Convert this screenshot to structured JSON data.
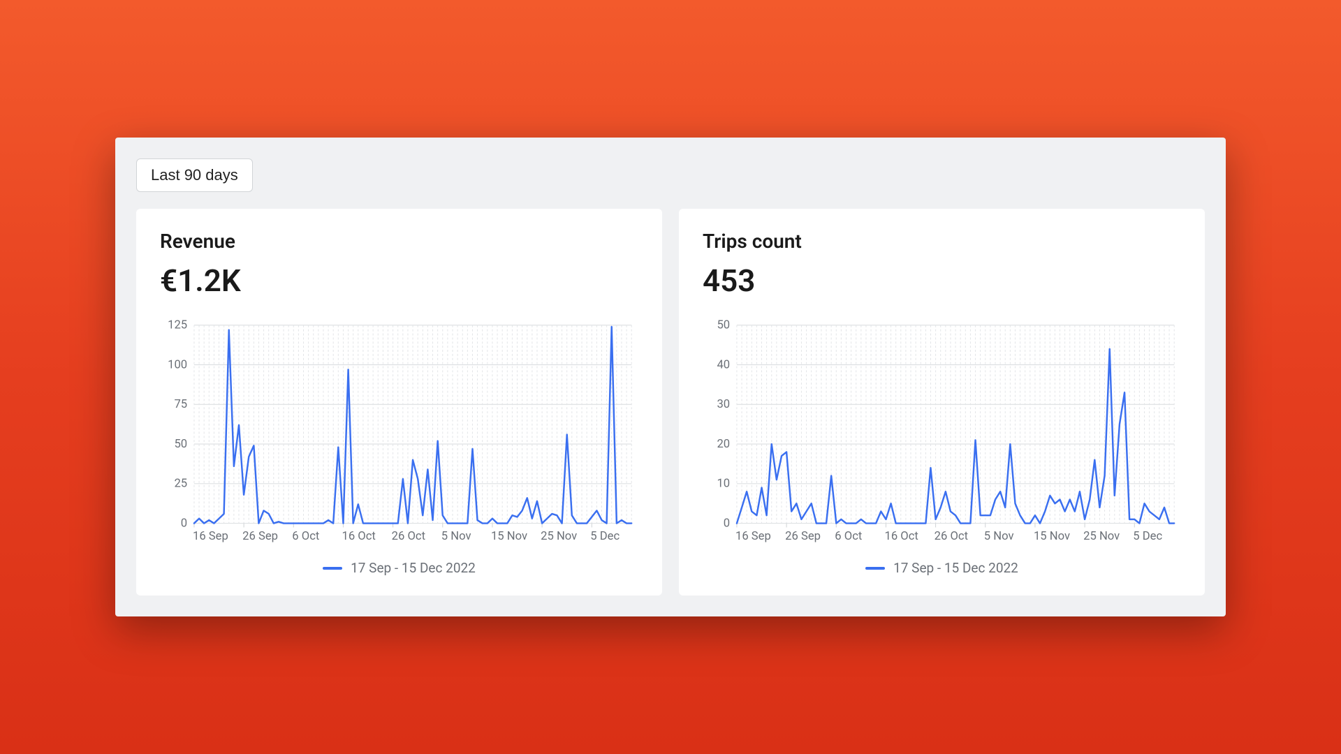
{
  "controls": {
    "date_range_label": "Last 90 days"
  },
  "cards": {
    "revenue": {
      "title": "Revenue",
      "value": "€1.2K",
      "legend": "17 Sep - 15 Dec 2022"
    },
    "trips": {
      "title": "Trips count",
      "value": "453",
      "legend": "17 Sep - 15 Dec 2022"
    }
  },
  "colors": {
    "series": "#3a6ff0"
  },
  "chart_data": [
    {
      "id": "revenue",
      "type": "line",
      "title": "Revenue",
      "ylabel": "",
      "xlabel": "",
      "ylim": [
        0,
        125
      ],
      "y_ticks": [
        0,
        25,
        50,
        75,
        100,
        125
      ],
      "x_tick_labels": [
        "16 Sep",
        "26 Sep",
        "6 Oct",
        "16 Oct",
        "26 Oct",
        "5 Nov",
        "15 Nov",
        "25 Nov",
        "5 Dec"
      ],
      "x_tick_indices": [
        0,
        10,
        20,
        30,
        40,
        50,
        60,
        70,
        80
      ],
      "legend": "17 Sep - 15 Dec 2022",
      "series": [
        {
          "name": "17 Sep - 15 Dec 2022",
          "x": [
            0,
            1,
            2,
            3,
            4,
            5,
            6,
            7,
            8,
            9,
            10,
            11,
            12,
            13,
            14,
            15,
            16,
            17,
            18,
            19,
            20,
            21,
            22,
            23,
            24,
            25,
            26,
            27,
            28,
            29,
            30,
            31,
            32,
            33,
            34,
            35,
            36,
            37,
            38,
            39,
            40,
            41,
            42,
            43,
            44,
            45,
            46,
            47,
            48,
            49,
            50,
            51,
            52,
            53,
            54,
            55,
            56,
            57,
            58,
            59,
            60,
            61,
            62,
            63,
            64,
            65,
            66,
            67,
            68,
            69,
            70,
            71,
            72,
            73,
            74,
            75,
            76,
            77,
            78,
            79,
            80,
            81,
            82,
            83,
            84,
            85,
            86,
            87,
            88
          ],
          "values": [
            0,
            3,
            0,
            2,
            0,
            3,
            6,
            122,
            36,
            62,
            18,
            42,
            49,
            0,
            8,
            6,
            0,
            1,
            0,
            0,
            0,
            0,
            0,
            0,
            0,
            0,
            0,
            2,
            0,
            48,
            0,
            97,
            0,
            12,
            0,
            0,
            0,
            0,
            0,
            0,
            0,
            0,
            28,
            0,
            40,
            28,
            5,
            34,
            2,
            52,
            5,
            0,
            0,
            0,
            0,
            0,
            47,
            2,
            0,
            0,
            3,
            0,
            0,
            0,
            5,
            4,
            8,
            16,
            3,
            14,
            0,
            3,
            6,
            5,
            0,
            56,
            5,
            0,
            0,
            0,
            4,
            8,
            2,
            0,
            124,
            0,
            2,
            0,
            0
          ]
        }
      ]
    },
    {
      "id": "trips",
      "type": "line",
      "title": "Trips count",
      "ylabel": "",
      "xlabel": "",
      "ylim": [
        0,
        50
      ],
      "y_ticks": [
        0,
        10,
        20,
        30,
        40,
        50
      ],
      "x_tick_labels": [
        "16 Sep",
        "26 Sep",
        "6 Oct",
        "16 Oct",
        "26 Oct",
        "5 Nov",
        "15 Nov",
        "25 Nov",
        "5 Dec"
      ],
      "x_tick_indices": [
        0,
        10,
        20,
        30,
        40,
        50,
        60,
        70,
        80
      ],
      "legend": "17 Sep - 15 Dec 2022",
      "series": [
        {
          "name": "17 Sep - 15 Dec 2022",
          "x": [
            0,
            1,
            2,
            3,
            4,
            5,
            6,
            7,
            8,
            9,
            10,
            11,
            12,
            13,
            14,
            15,
            16,
            17,
            18,
            19,
            20,
            21,
            22,
            23,
            24,
            25,
            26,
            27,
            28,
            29,
            30,
            31,
            32,
            33,
            34,
            35,
            36,
            37,
            38,
            39,
            40,
            41,
            42,
            43,
            44,
            45,
            46,
            47,
            48,
            49,
            50,
            51,
            52,
            53,
            54,
            55,
            56,
            57,
            58,
            59,
            60,
            61,
            62,
            63,
            64,
            65,
            66,
            67,
            68,
            69,
            70,
            71,
            72,
            73,
            74,
            75,
            76,
            77,
            78,
            79,
            80,
            81,
            82,
            83,
            84,
            85,
            86,
            87,
            88
          ],
          "values": [
            0,
            4,
            8,
            3,
            2,
            9,
            2,
            20,
            11,
            17,
            18,
            3,
            5,
            1,
            3,
            5,
            0,
            0,
            0,
            12,
            0,
            1,
            0,
            0,
            0,
            1,
            0,
            0,
            0,
            3,
            1,
            5,
            0,
            0,
            0,
            0,
            0,
            0,
            0,
            14,
            1,
            4,
            8,
            3,
            2,
            0,
            0,
            0,
            21,
            2,
            2,
            2,
            6,
            8,
            4,
            20,
            5,
            2,
            0,
            0,
            2,
            0,
            3,
            7,
            5,
            6,
            3,
            6,
            3,
            8,
            1,
            6,
            16,
            4,
            12,
            44,
            7,
            25,
            33,
            1,
            1,
            0,
            5,
            3,
            2,
            1,
            4,
            0,
            0
          ]
        }
      ]
    }
  ]
}
